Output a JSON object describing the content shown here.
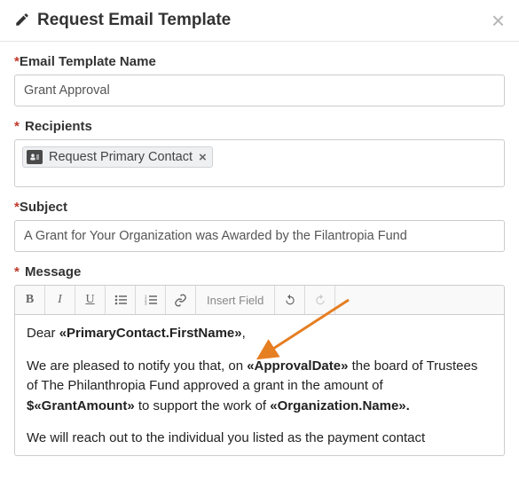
{
  "header": {
    "title": "Request Email Template"
  },
  "fields": {
    "name": {
      "label": "Email Template Name",
      "value": "Grant Approval"
    },
    "recipients": {
      "label": " Recipients",
      "chip": {
        "text": "Request Primary Contact"
      }
    },
    "subject": {
      "label": "Subject",
      "value": "A Grant for Your Organization was Awarded by the Filantropia Fund"
    },
    "message": {
      "label": " Message",
      "toolbar": {
        "insert": "Insert Field"
      },
      "body": {
        "greeting_pre": "Dear ",
        "greeting_merge": "«PrimaryContact.FirstName»",
        "greeting_post": ",",
        "p1_a": "We are pleased to notify you that, on ",
        "p1_m1": "«ApprovalDate»",
        "p1_b": " the board of Trustees of The Philanthropia Fund approved a grant in the amount of ",
        "p1_m2": "$«GrantAmount»",
        "p1_c": " to support the work of ",
        "p1_m3": "«Organization.Name».",
        "p2": "We will reach out to the individual you listed as the payment contact"
      }
    }
  }
}
